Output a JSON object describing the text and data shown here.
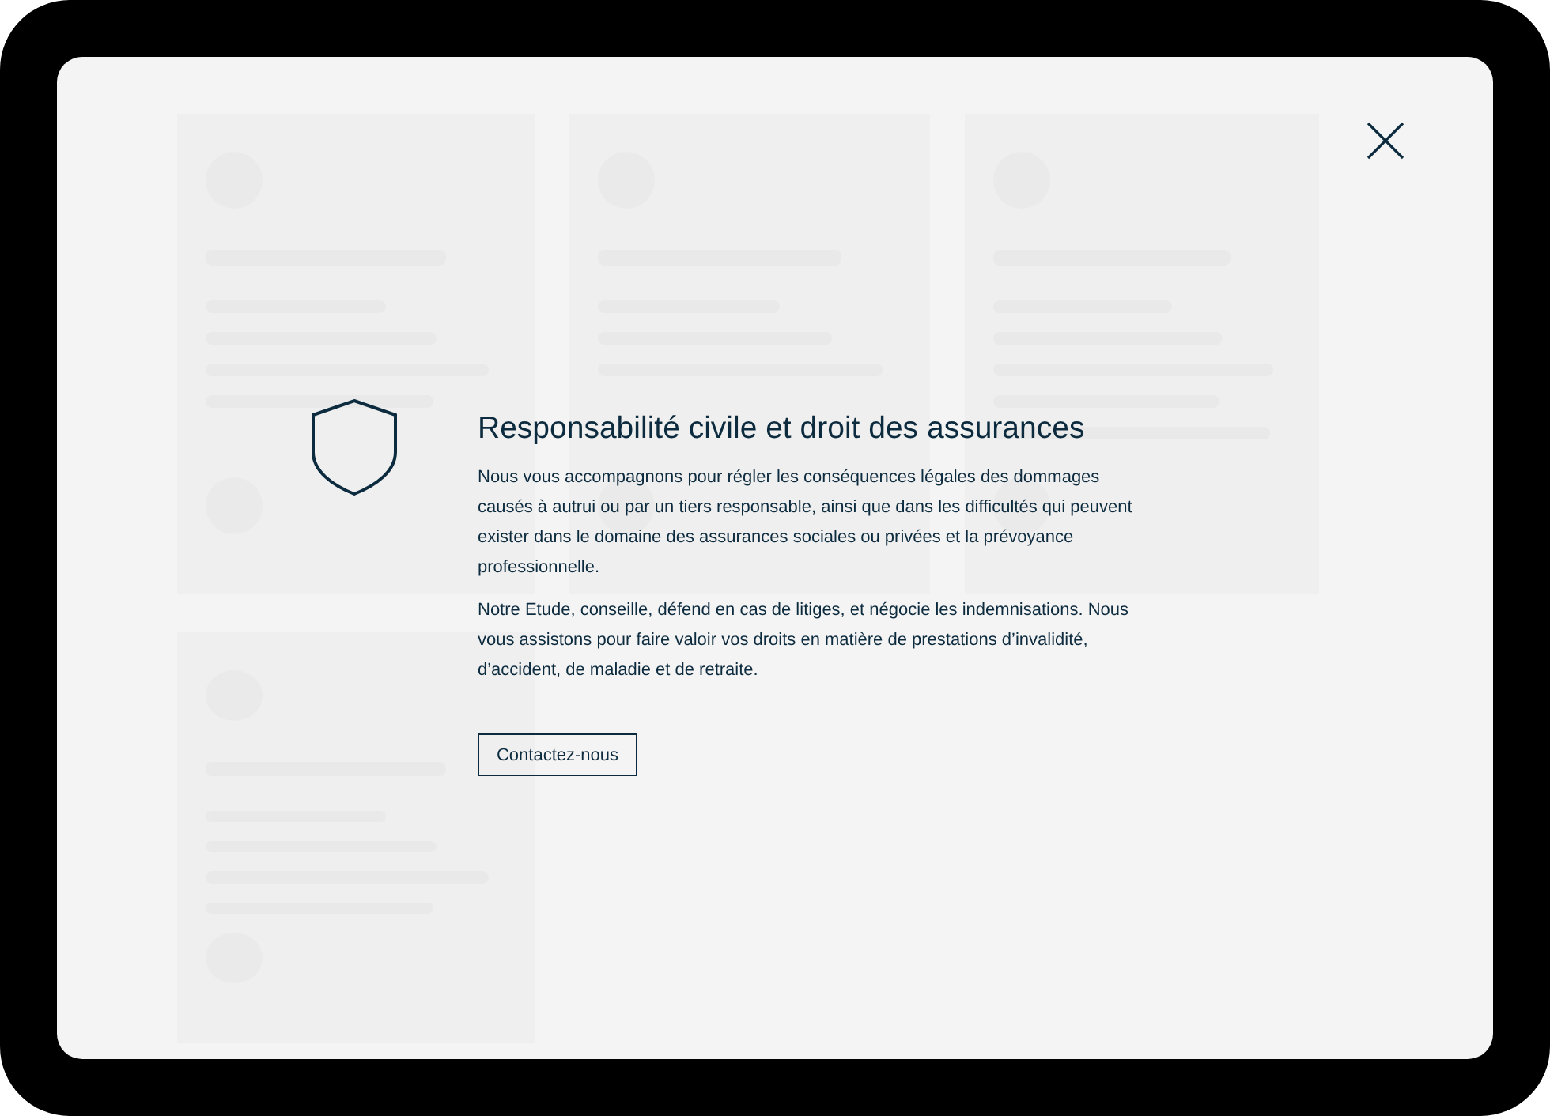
{
  "modal": {
    "title": "Responsabilité civile et droit des assurances",
    "paragraphs": [
      "Nous vous accompagnons pour régler les conséquences légales des dommages causés à autrui ou par un tiers responsable, ainsi que dans les difficultés qui peuvent exister dans le domaine des assurances sociales ou privées et la prévoyance professionnelle.",
      "Notre Etude, conseille, défend en cas de litiges, et négocie les indemnisations. Nous vous assistons pour faire valoir vos droits en matière de prestations d’invalidité, d’accident, de maladie et de retraite."
    ],
    "button": "Contactez-nous"
  }
}
